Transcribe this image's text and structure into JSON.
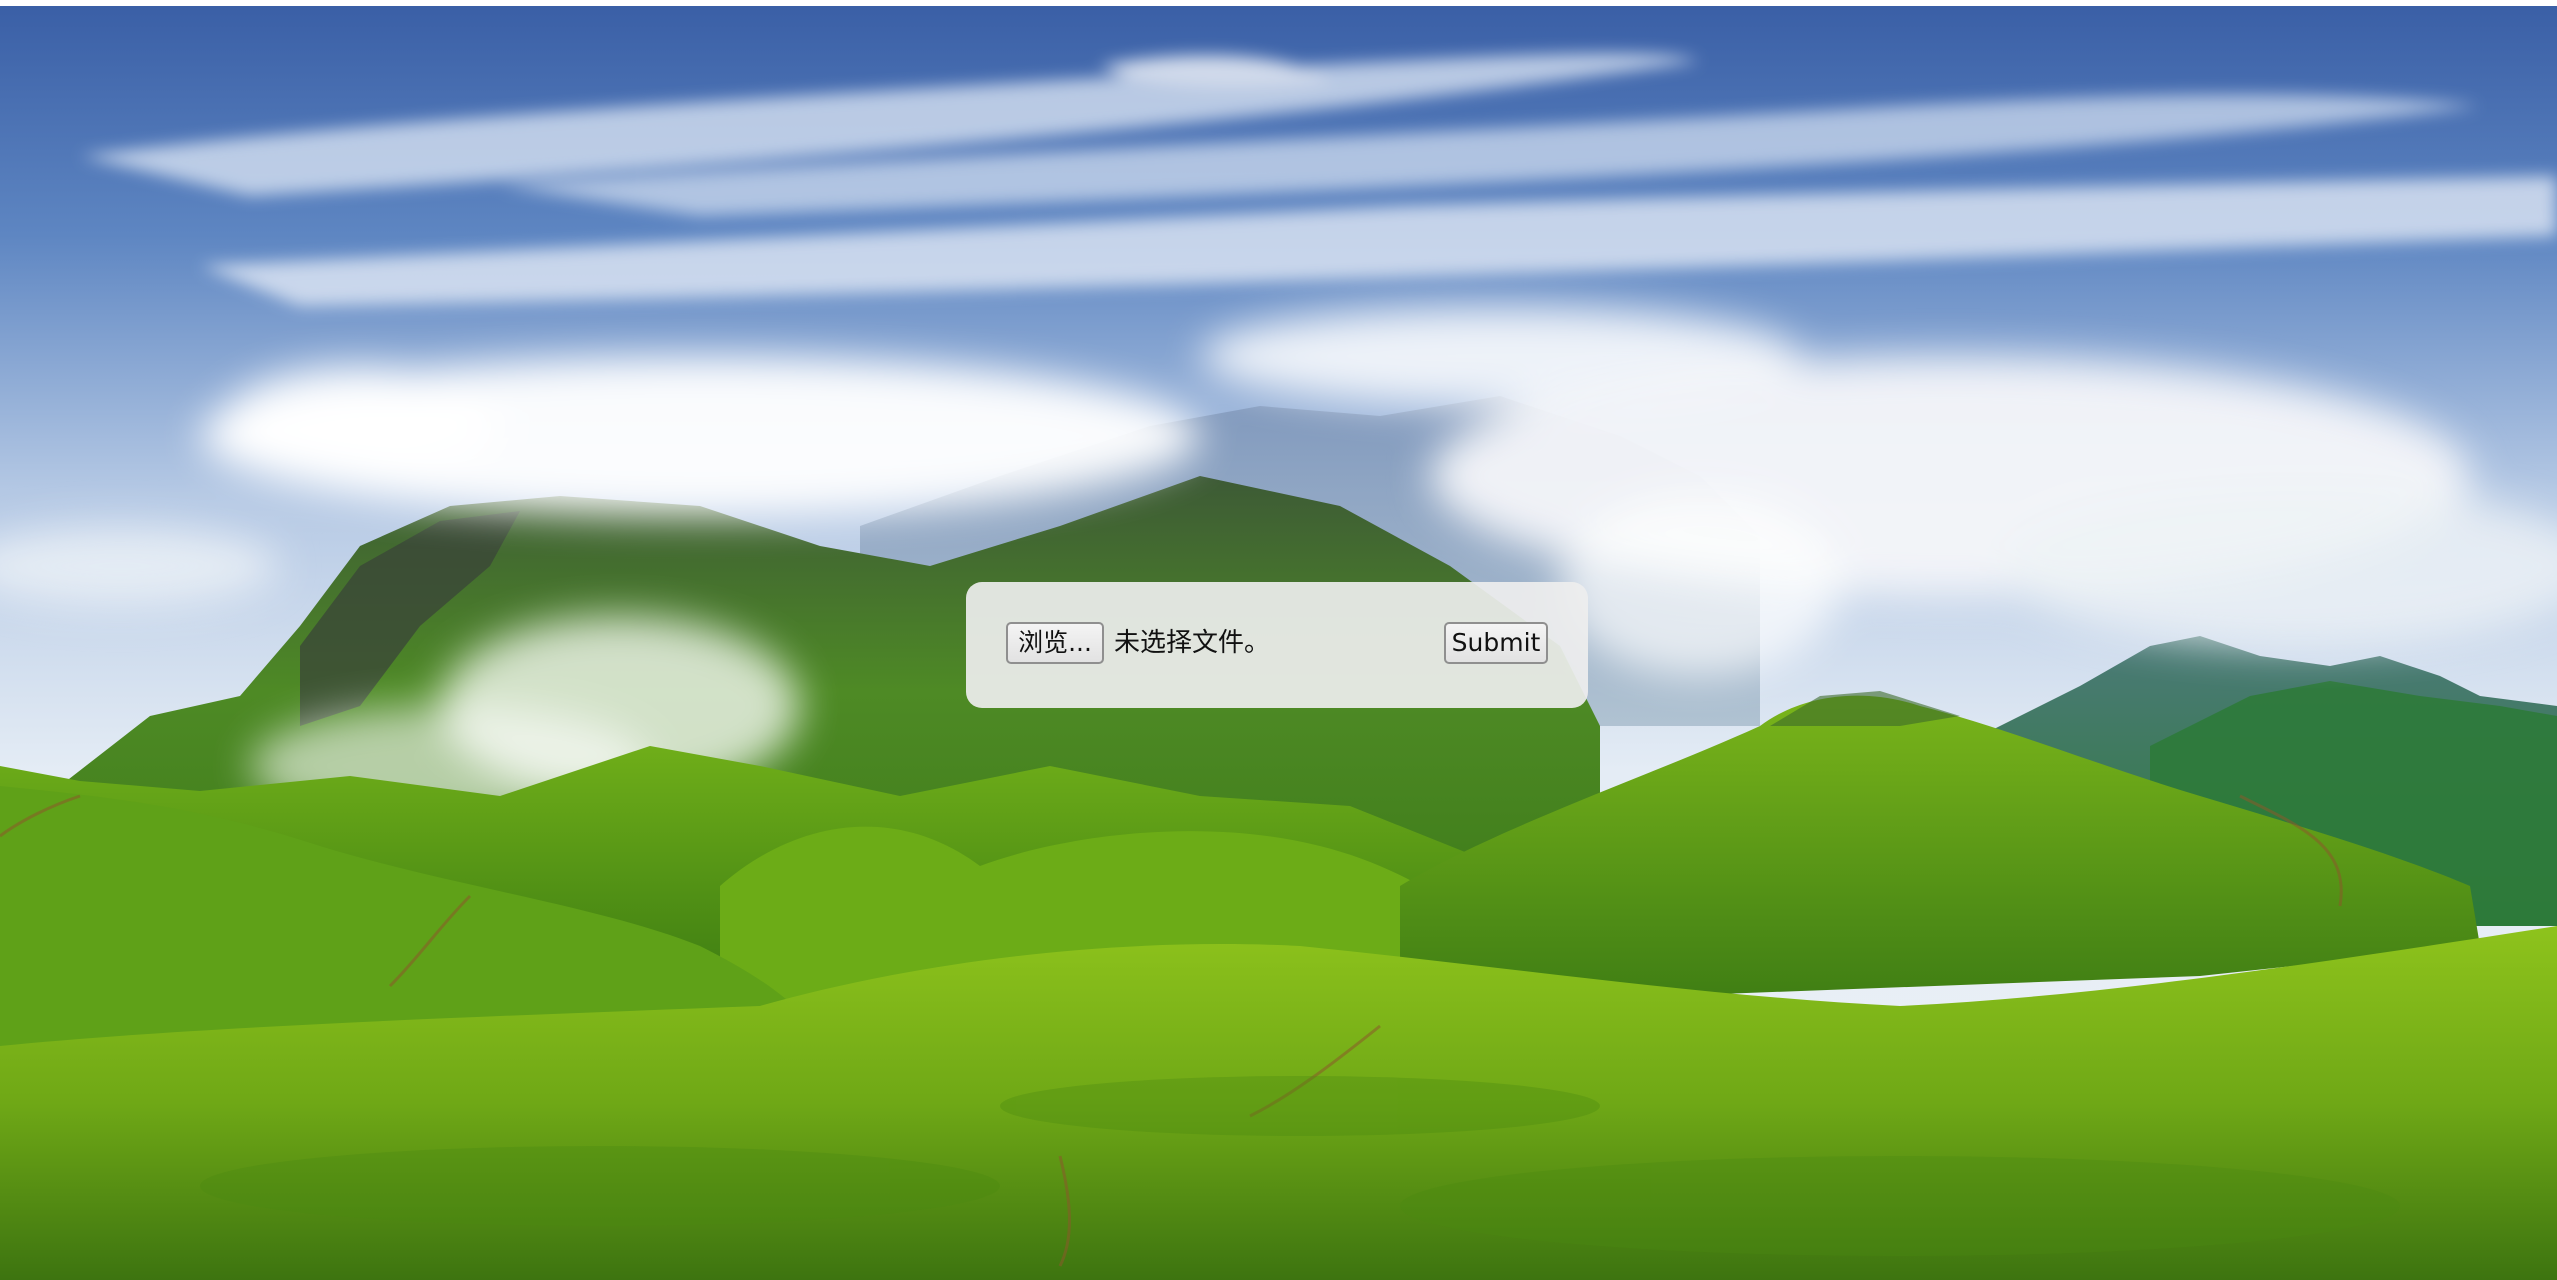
{
  "upload_form": {
    "browse_label": "浏览...",
    "file_status": "未选择文件。",
    "submit_label": "Submit"
  },
  "background": {
    "scene": "green mountain landscape with clouds",
    "colors": {
      "sky_top": "#3c62a8",
      "sky_mid": "#a9c2e0",
      "cloud": "#f4f6f9",
      "hill_dark": "#2f6e1e",
      "hill_mid": "#5c9b1c",
      "hill_light": "#8fc21a",
      "foreground": "#7db513"
    }
  }
}
